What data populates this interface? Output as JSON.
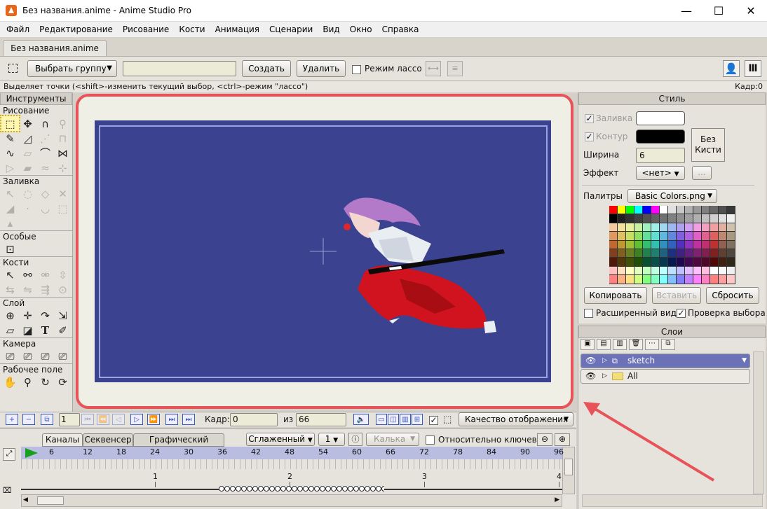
{
  "window": {
    "title": "Без названия.anime - Anime Studio Pro",
    "minimize": "—",
    "maximize": "☐",
    "close": "✕"
  },
  "menu": [
    "Файл",
    "Редактирование",
    "Рисование",
    "Кости",
    "Анимация",
    "Сценарии",
    "Вид",
    "Окно",
    "Справка"
  ],
  "doc_tab": "Без названия.anime",
  "toolbar": {
    "select_group": "Выбрать группу",
    "select_group_arrow": "▼",
    "create": "Создать",
    "delete": "Удалить",
    "lasso_label": "Режим лассо"
  },
  "status": {
    "hint": "Выделяет точки (<shift>-изменить текущий выбор, <ctrl>-режим \"лассо\")",
    "frame": "Кадр:0"
  },
  "tools": {
    "header": "Инструменты",
    "sections": {
      "draw": "Рисование",
      "fill": "Заливка",
      "special": "Особые",
      "bones": "Кости",
      "layer": "Слой",
      "camera": "Камера",
      "workspace": "Рабочее поле"
    }
  },
  "style": {
    "header": "Стиль",
    "fill_label": "Заливка",
    "stroke_label": "Контур",
    "width_label": "Ширина",
    "width_value": "6",
    "effect_label": "Эффект",
    "effect_value": "<нет>",
    "effect_more": "...",
    "brush_button": "Без Кисти",
    "palettes_label": "Палитры",
    "palette_value": "Basic Colors.png",
    "copy": "Копировать",
    "paste": "Вставить",
    "reset": "Сбросить",
    "advanced": "Расширенный вид",
    "check_selection": "Проверка выбора",
    "fill_color": "#ffffff",
    "stroke_color": "#000000"
  },
  "layers": {
    "header": "Слои",
    "items": [
      {
        "name": "sketch",
        "selected": true
      },
      {
        "name": "All",
        "selected": false
      }
    ]
  },
  "playback": {
    "frame_field": "1",
    "frame_label": "Кадр:",
    "frame_value": "0",
    "of_label": "из",
    "total": "66",
    "quality": "Качество отображения"
  },
  "timeline": {
    "tabs": [
      "Каналы",
      "Секвенсер",
      "Графический режим"
    ],
    "interp": "Сглаженный",
    "interp_num": "1",
    "ease": "Калька",
    "relative": "Относительно ключевых",
    "ruler_marks": [
      "6",
      "12",
      "18",
      "24",
      "30",
      "36",
      "42",
      "48",
      "54",
      "60",
      "66",
      "72",
      "78",
      "84",
      "90",
      "96"
    ],
    "seconds": [
      "1",
      "2",
      "3",
      "4"
    ]
  }
}
